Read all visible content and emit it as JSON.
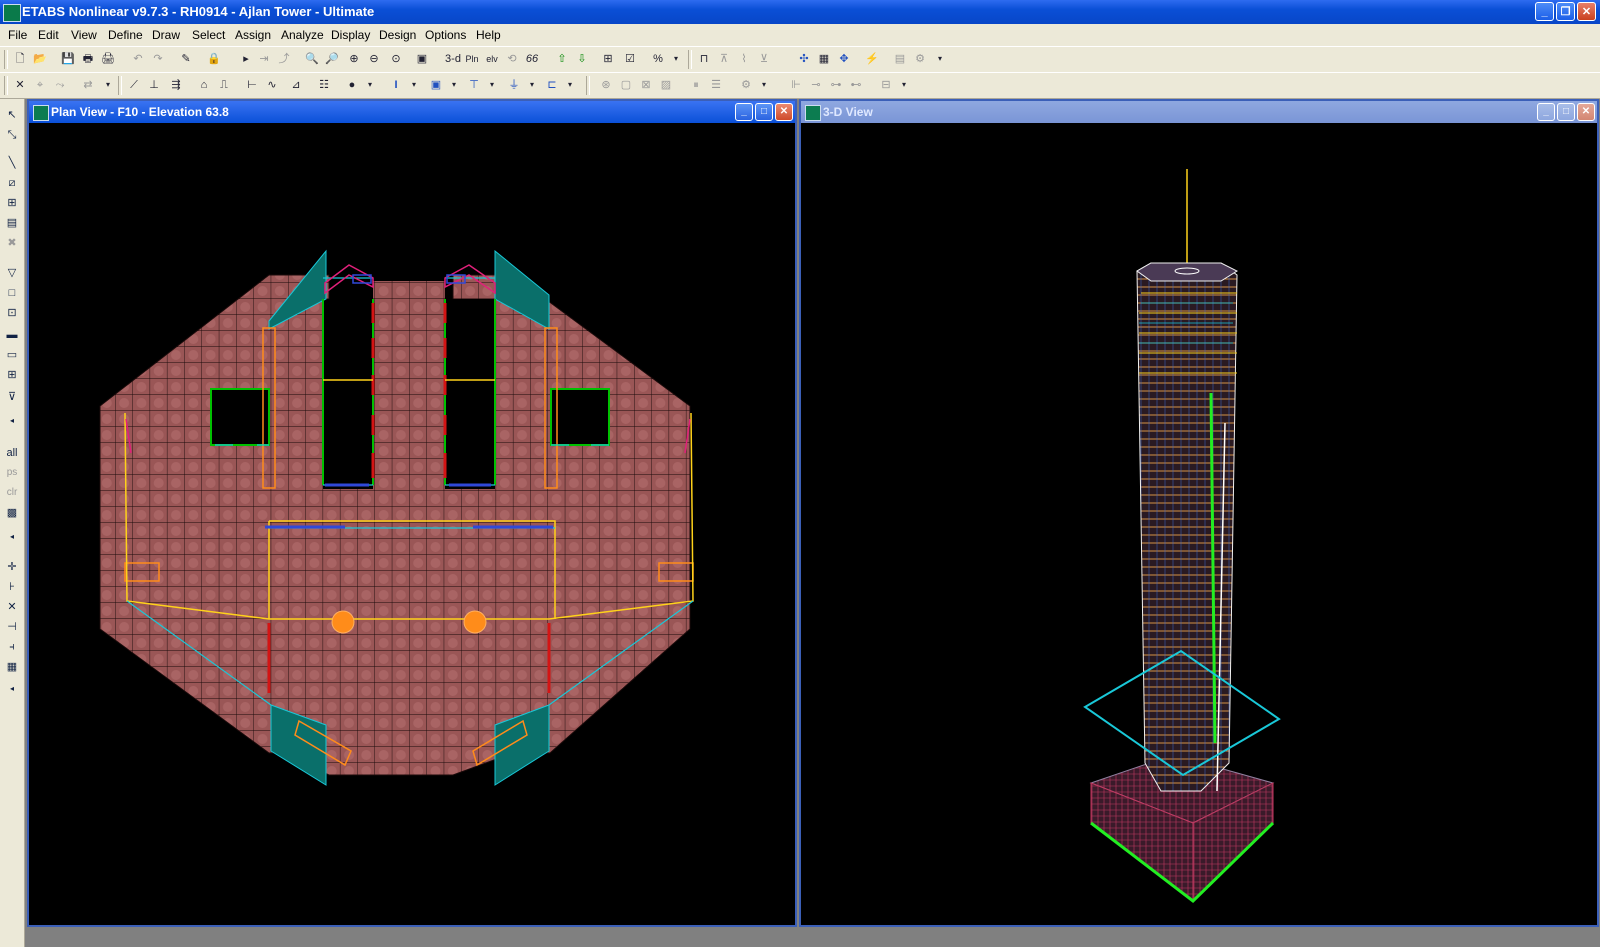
{
  "app": {
    "title": "ETABS Nonlinear v9.7.3 - RH0914 - Ajlan Tower - Ultimate",
    "window_buttons": [
      "_",
      "❐",
      "✕"
    ]
  },
  "menu": [
    "File",
    "Edit",
    "View",
    "Define",
    "Draw",
    "Select",
    "Assign",
    "Analyze",
    "Display",
    "Design",
    "Options",
    "Help"
  ],
  "toolbar": {
    "view_3d_label": "3-d",
    "view_plan_label": "Pln",
    "view_elev_label": "elv",
    "view_rot_label": "66",
    "percent_label": "%"
  },
  "sidebar": {
    "all_label": "all",
    "ps_label": "ps",
    "clr_label": "clr"
  },
  "plan_view": {
    "title": "Plan View - F10 - Elevation 63.8",
    "colors": {
      "slab": "#9a5656",
      "mesh": "#1a0a0a",
      "wall_green": "#00c000",
      "wall_orange": "#ff8c1a",
      "yellow": "#ffd21a",
      "cyan": "#19c8d8",
      "teal": "#0a6f6a",
      "red": "#d41414",
      "magenta": "#e0207a",
      "blue": "#3048d8"
    }
  },
  "view_3d": {
    "title": "3-D View",
    "colors": {
      "cyan": "#19c8d8",
      "green": "#22ee22",
      "yellow": "#ffd21a"
    }
  }
}
